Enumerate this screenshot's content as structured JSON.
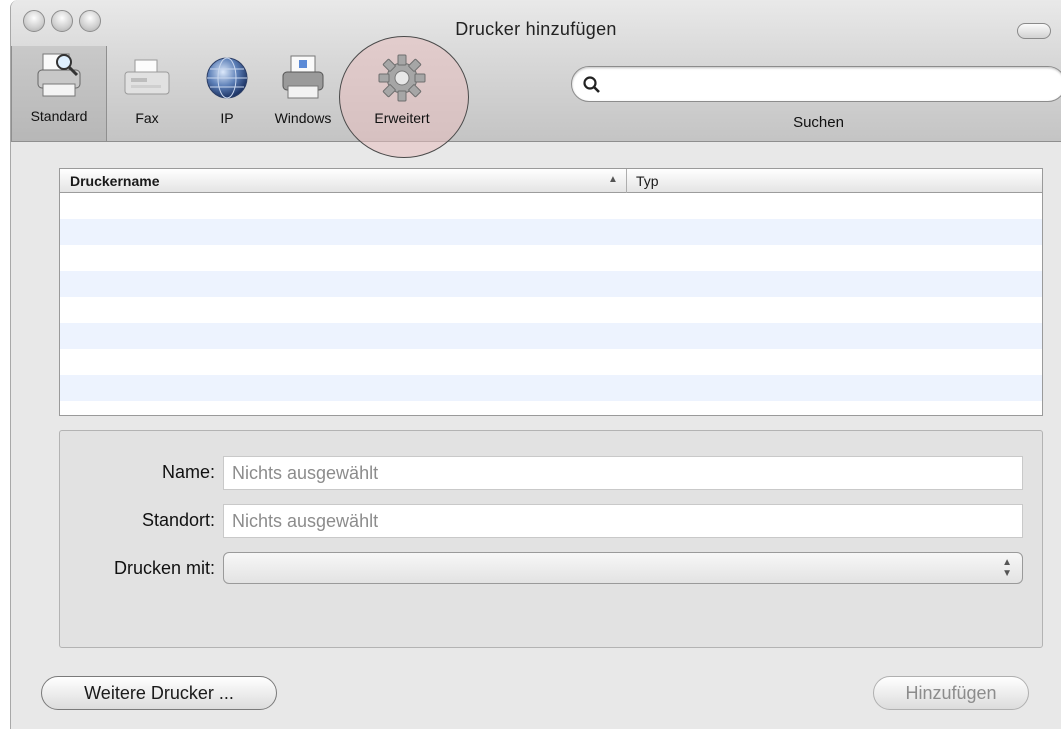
{
  "window": {
    "title": "Drucker hinzufügen"
  },
  "toolbar": {
    "items": [
      {
        "label": "Standard",
        "icon": "printer-search-icon"
      },
      {
        "label": "Fax",
        "icon": "fax-icon"
      },
      {
        "label": "IP",
        "icon": "globe-icon"
      },
      {
        "label": "Windows",
        "icon": "windows-printer-icon"
      },
      {
        "label": "Erweitert",
        "icon": "gear-icon"
      }
    ],
    "selected": "Standard",
    "highlighted": "Erweitert"
  },
  "search": {
    "label": "Suchen",
    "value": ""
  },
  "table": {
    "columns": [
      "Druckername",
      "Typ"
    ],
    "sort_column": "Druckername",
    "sort_direction": "ascending",
    "rows": []
  },
  "details": {
    "name_label": "Name:",
    "name_value": "Nichts ausgewählt",
    "location_label": "Standort:",
    "location_value": "Nichts ausgewählt",
    "driver_label": "Drucken mit:",
    "driver_value": ""
  },
  "buttons": {
    "more_printers": "Weitere Drucker ...",
    "add": "Hinzufügen"
  }
}
